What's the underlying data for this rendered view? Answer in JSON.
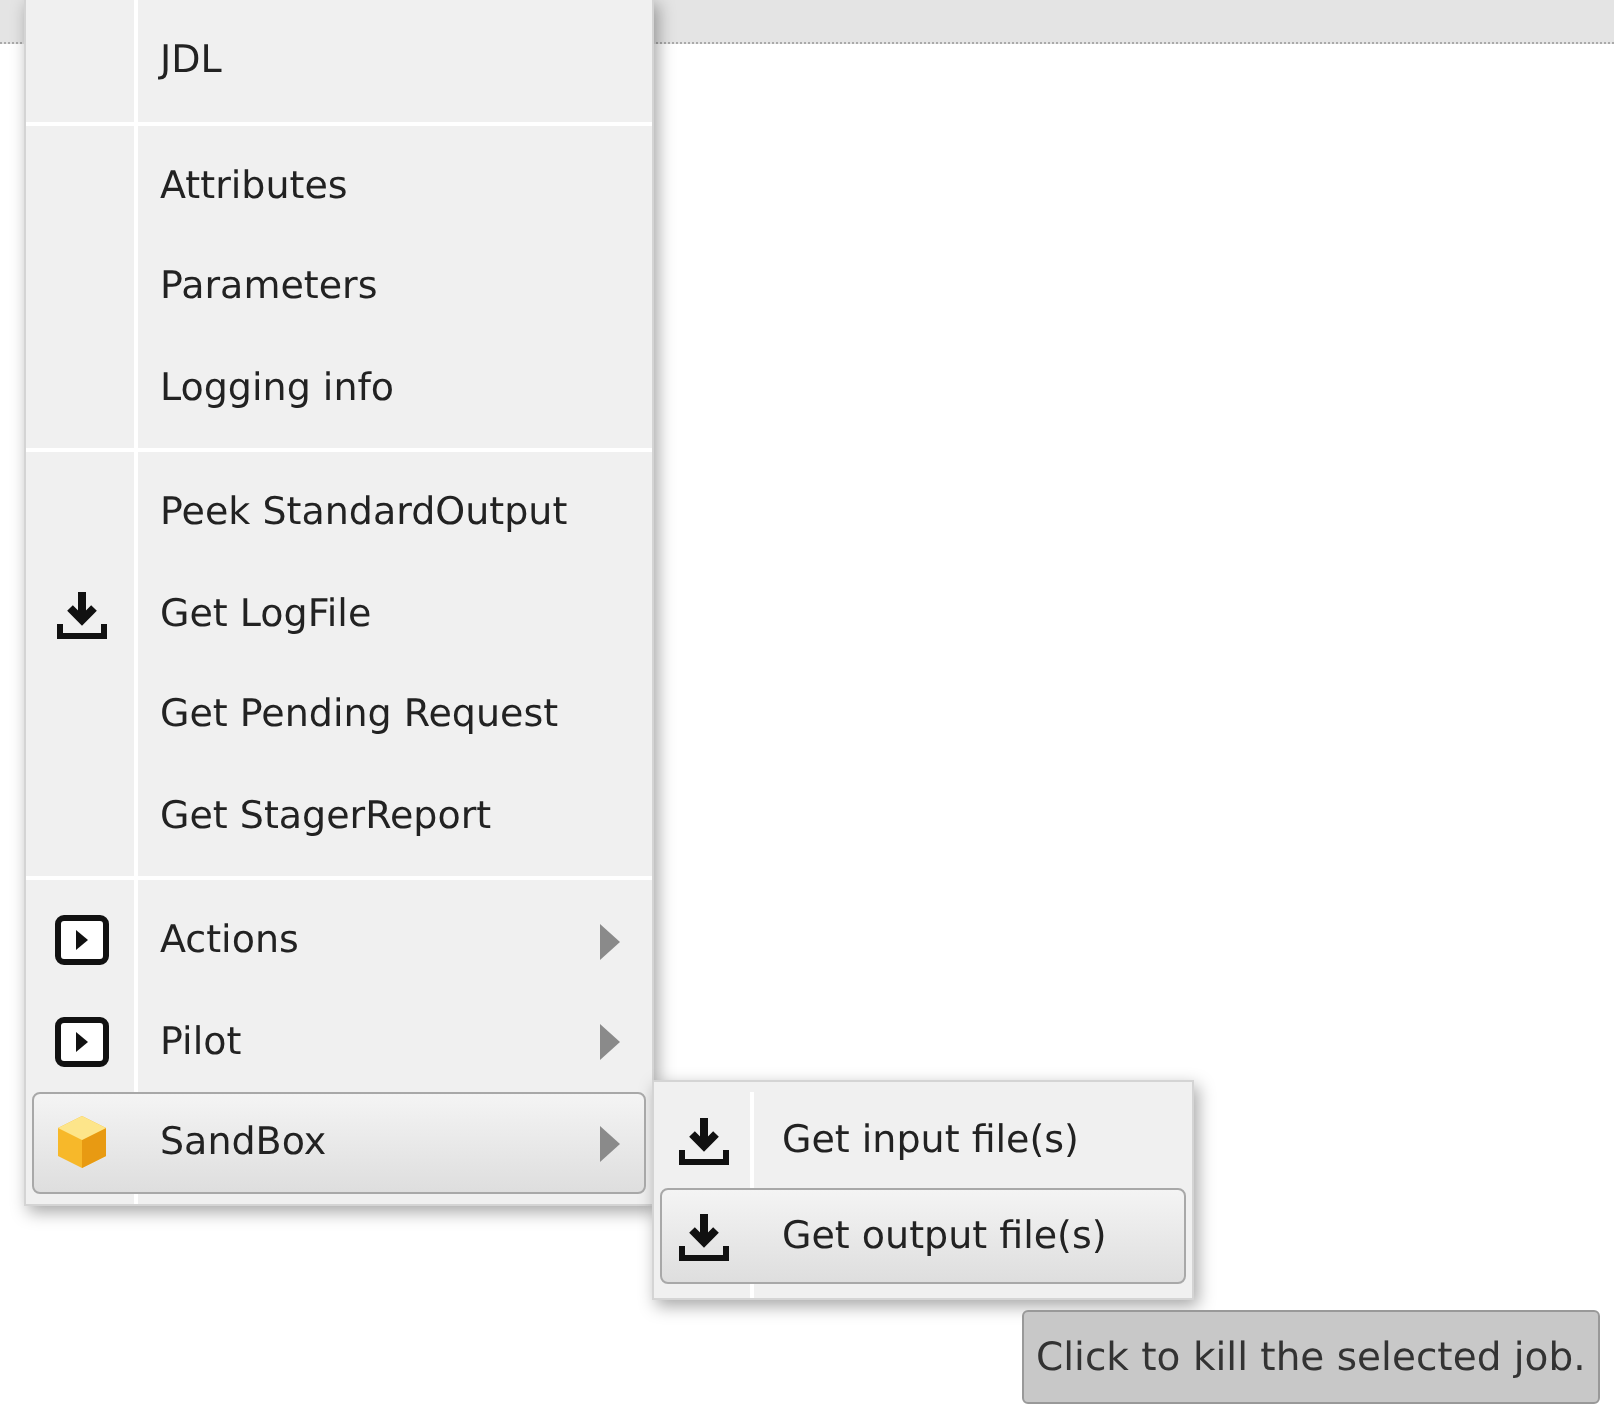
{
  "context_menu": {
    "groups": [
      {
        "items": [
          {
            "label": "JDL",
            "kind": "plain",
            "has_submenu": false,
            "selected": false
          }
        ]
      },
      {
        "items": [
          {
            "label": "Attributes",
            "kind": "plain",
            "has_submenu": false,
            "selected": false
          },
          {
            "label": "Parameters",
            "kind": "plain",
            "has_submenu": false,
            "selected": false
          },
          {
            "label": "Logging info",
            "kind": "plain",
            "has_submenu": false,
            "selected": false
          }
        ]
      },
      {
        "items": [
          {
            "label": "Peek StandardOutput",
            "kind": "plain",
            "has_submenu": false,
            "selected": false
          },
          {
            "label": "Get LogFile",
            "kind": "download",
            "has_submenu": false,
            "selected": false
          },
          {
            "label": "Get Pending Request",
            "kind": "plain",
            "has_submenu": false,
            "selected": false
          },
          {
            "label": "Get StagerReport",
            "kind": "plain",
            "has_submenu": false,
            "selected": false
          }
        ]
      },
      {
        "items": [
          {
            "label": "Actions",
            "kind": "play",
            "has_submenu": true,
            "selected": false
          },
          {
            "label": "Pilot",
            "kind": "play",
            "has_submenu": true,
            "selected": false
          },
          {
            "label": "SandBox",
            "kind": "box",
            "has_submenu": true,
            "selected": true
          }
        ]
      }
    ]
  },
  "submenu": {
    "items": [
      {
        "label": "Get input file(s)",
        "kind": "download",
        "selected": false
      },
      {
        "label": "Get output file(s)",
        "kind": "download",
        "selected": true
      }
    ]
  },
  "tooltip": {
    "text": "Click to kill the selected job."
  }
}
